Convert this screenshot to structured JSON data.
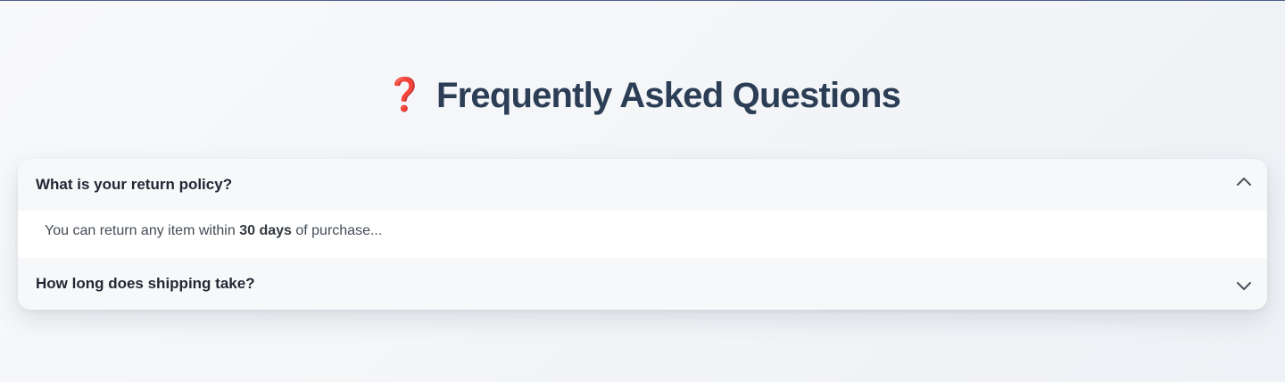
{
  "page": {
    "title_icon": "question-mark-icon",
    "title": "Frequently Asked Questions",
    "accent_color": "#e0141e",
    "title_color": "#2c3e55"
  },
  "faq": {
    "items": [
      {
        "question": "What is your return policy?",
        "expanded": true,
        "toggle_icon": "chevron-up-icon",
        "answer": {
          "prefix": "You can return any item within ",
          "emphasis": "30 days",
          "suffix": " of purchase..."
        }
      },
      {
        "question": "How long does shipping take?",
        "expanded": false,
        "toggle_icon": "chevron-down-icon"
      }
    ]
  }
}
